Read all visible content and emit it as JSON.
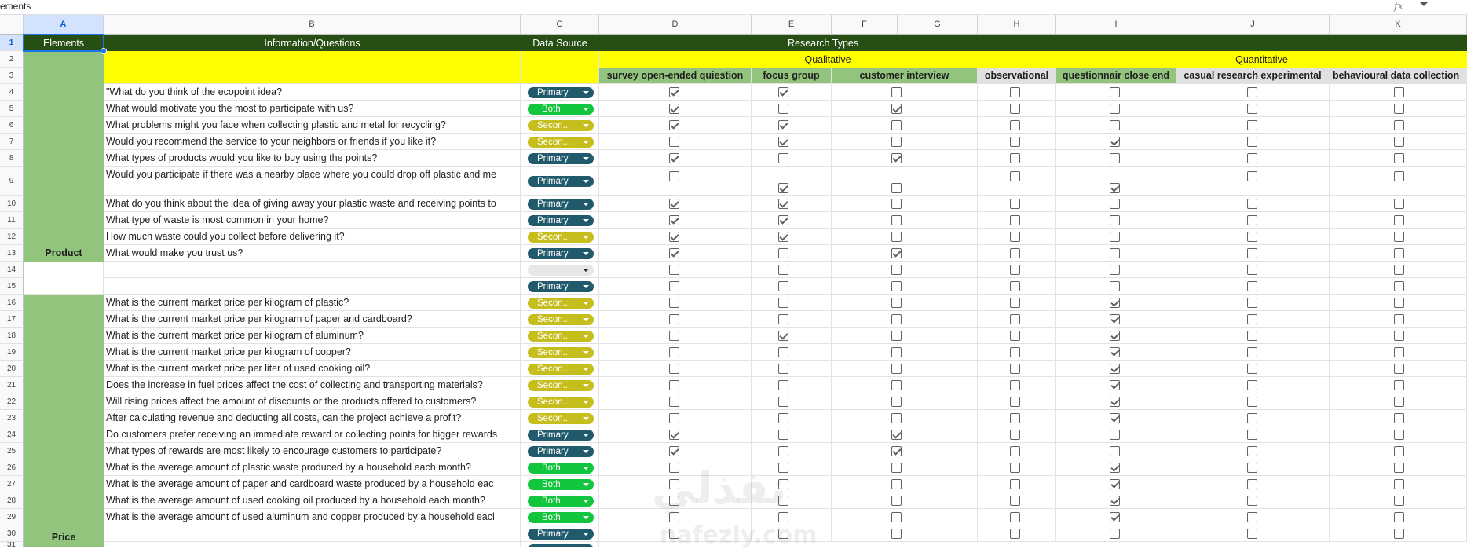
{
  "formula_bar": {
    "cell_content": "ements",
    "fx_label": "fx"
  },
  "columns": [
    "A",
    "B",
    "C",
    "D",
    "E",
    "F",
    "G",
    "H",
    "I",
    "J",
    "K"
  ],
  "selected_column": "A",
  "selected_row": 1,
  "headers": {
    "elements": "Elements",
    "info": "Information/Questions",
    "source": "Data Source",
    "research_types": "Research Types",
    "qualitative": "Qualitative",
    "quantitative": "Quantitative"
  },
  "methods": [
    "survey open-ended quiestion",
    "focus group",
    "customer interview",
    "observational",
    "questionnair close end",
    "casual research experimental",
    "behavioural data collection"
  ],
  "groups": {
    "product": "Product",
    "price": "Price"
  },
  "colors": {
    "header_green": "#274e13",
    "light_green": "#93c47d",
    "yellow": "#ffff00",
    "primary_chip": "#215a6c",
    "both_chip": "#11c63c",
    "secondary_chip": "#c6be1c",
    "selection": "#1a73e8"
  },
  "rows": [
    {
      "n": 4,
      "q": "\"What do you think of the ecopoint idea?",
      "src": "Primary",
      "checks": [
        1,
        1,
        0,
        0,
        0,
        0,
        0
      ]
    },
    {
      "n": 5,
      "q": "What would motivate you the most to participate with us?",
      "src": "Both",
      "checks": [
        1,
        0,
        1,
        0,
        0,
        0,
        0
      ]
    },
    {
      "n": 6,
      "q": "What problems might you face when collecting plastic and metal for recycling?",
      "src": "Secon...",
      "checks": [
        1,
        1,
        0,
        0,
        0,
        0,
        0
      ]
    },
    {
      "n": 7,
      "q": "Would you recommend the service to your neighbors or friends if you like it?",
      "src": "Secon...",
      "checks": [
        0,
        1,
        0,
        0,
        1,
        0,
        0
      ]
    },
    {
      "n": 8,
      "q": "What types of products would you like to buy using the points?",
      "src": "Primary",
      "checks": [
        1,
        0,
        1,
        0,
        0,
        0,
        0
      ]
    },
    {
      "n": 9,
      "q": "Would you participate if there was a nearby place where you could drop off plastic and me",
      "src": "Primary",
      "checks": [
        0,
        1,
        0,
        0,
        1,
        0,
        0
      ]
    },
    {
      "n": 10,
      "q": "What do you think about the idea of giving away your plastic waste and receiving points to",
      "src": "Primary",
      "checks": [
        1,
        1,
        0,
        0,
        0,
        0,
        0
      ]
    },
    {
      "n": 11,
      "q": "What type of waste is most common in your home?",
      "src": "Primary",
      "checks": [
        1,
        1,
        0,
        0,
        0,
        0,
        0
      ]
    },
    {
      "n": 12,
      "q": "How much waste could you collect before delivering it?",
      "src": "Secon...",
      "checks": [
        1,
        1,
        0,
        0,
        0,
        0,
        0
      ]
    },
    {
      "n": 13,
      "q": "What would make you trust us?",
      "src": "Primary",
      "checks": [
        1,
        0,
        1,
        0,
        0,
        0,
        0
      ]
    },
    {
      "n": 14,
      "q": "",
      "src": "",
      "checks": [
        0,
        0,
        0,
        0,
        0,
        0,
        0
      ]
    },
    {
      "n": 15,
      "q": "",
      "src": "Primary",
      "checks": [
        0,
        0,
        0,
        0,
        0,
        0,
        0
      ]
    },
    {
      "n": 16,
      "q": "What is the current market price per kilogram of plastic?",
      "src": "Secon...",
      "checks": [
        0,
        0,
        0,
        0,
        1,
        0,
        0
      ]
    },
    {
      "n": 17,
      "q": "What is the current market price per kilogram of paper and cardboard?",
      "src": "Secon...",
      "checks": [
        0,
        0,
        0,
        0,
        1,
        0,
        0
      ]
    },
    {
      "n": 18,
      "q": "What is the current market price per kilogram of aluminum?",
      "src": "Secon...",
      "checks": [
        0,
        1,
        0,
        0,
        1,
        0,
        0
      ]
    },
    {
      "n": 19,
      "q": "What is the current market price per kilogram of copper?",
      "src": "Secon...",
      "checks": [
        0,
        0,
        0,
        0,
        1,
        0,
        0
      ]
    },
    {
      "n": 20,
      "q": "What is the current market price per liter of used cooking oil?",
      "src": "Secon...",
      "checks": [
        0,
        0,
        0,
        0,
        1,
        0,
        0
      ]
    },
    {
      "n": 21,
      "q": "Does the increase in fuel prices affect the cost of collecting and transporting materials?",
      "src": "Secon...",
      "checks": [
        0,
        0,
        0,
        0,
        1,
        0,
        0
      ]
    },
    {
      "n": 22,
      "q": "Will rising prices affect the amount of discounts or the products offered to customers?",
      "src": "Secon...",
      "checks": [
        0,
        0,
        0,
        0,
        1,
        0,
        0
      ]
    },
    {
      "n": 23,
      "q": "After calculating revenue and deducting all costs, can the project achieve a profit?",
      "src": "Secon...",
      "checks": [
        0,
        0,
        0,
        0,
        1,
        0,
        0
      ]
    },
    {
      "n": 24,
      "q": "Do customers prefer receiving an immediate reward or collecting points for bigger rewards",
      "src": "Primary",
      "checks": [
        1,
        0,
        1,
        0,
        0,
        0,
        0
      ]
    },
    {
      "n": 25,
      "q": "What types of rewards are most likely to encourage customers to participate?",
      "src": "Primary",
      "checks": [
        1,
        0,
        1,
        0,
        0,
        0,
        0
      ]
    },
    {
      "n": 26,
      "q": "What is the average amount of plastic waste produced by a household each month?",
      "src": "Both",
      "checks": [
        0,
        0,
        0,
        0,
        1,
        0,
        0
      ]
    },
    {
      "n": 27,
      "q": "What is the average amount of paper and cardboard waste produced by a household eac",
      "src": "Both",
      "checks": [
        0,
        0,
        0,
        0,
        1,
        0,
        0
      ]
    },
    {
      "n": 28,
      "q": "What is the average amount of used cooking oil produced by a household each month?",
      "src": "Both",
      "checks": [
        0,
        0,
        0,
        0,
        1,
        0,
        0
      ]
    },
    {
      "n": 29,
      "q": "What is the average amount of used aluminum and copper produced by a household eacl",
      "src": "Both",
      "checks": [
        0,
        0,
        0,
        0,
        1,
        0,
        0
      ]
    },
    {
      "n": 30,
      "q": "",
      "src": "Primary",
      "checks": [
        0,
        0,
        0,
        0,
        0,
        0,
        0
      ]
    }
  ],
  "watermark": {
    "line1": "نفذلي",
    "line2": "nafezly.com"
  }
}
